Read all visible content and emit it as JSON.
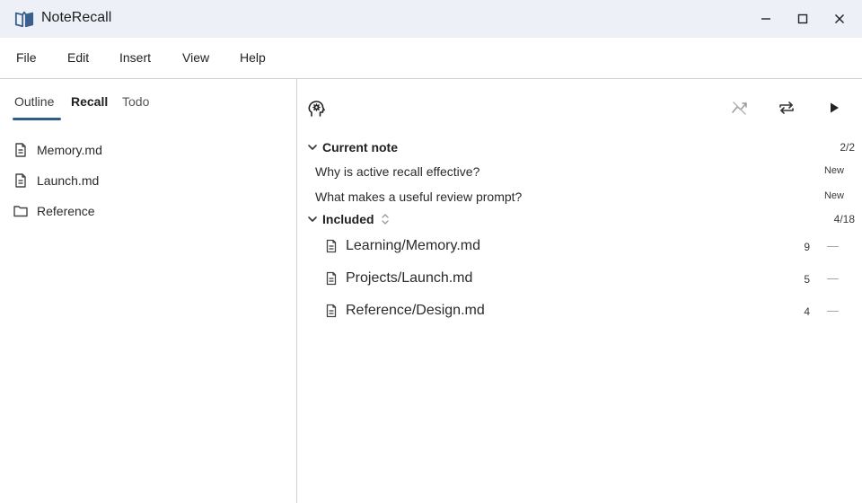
{
  "window": {
    "title": "NoteRecall",
    "icons": {
      "logo": "open-book-icon",
      "minimize": "minimize-icon",
      "maximize": "maximize-icon",
      "close": "close-icon"
    }
  },
  "menu": {
    "items": [
      "File",
      "Edit",
      "Insert",
      "View",
      "Help"
    ]
  },
  "sidebar": {
    "tabs": [
      {
        "label": "Outline",
        "active": false
      },
      {
        "label": "Recall",
        "active": true
      },
      {
        "label": "Todo",
        "active": false
      }
    ],
    "items": [
      {
        "label": "Memory.md",
        "icon": "document-icon"
      },
      {
        "label": "Launch.md",
        "icon": "document-icon"
      },
      {
        "label": "Reference",
        "icon": "folder-icon"
      }
    ]
  },
  "toolbar": {
    "icons": [
      "brain-icon",
      "trend-icon",
      "repeat-icon",
      "play-icon"
    ]
  },
  "current_note": {
    "title": "Current note",
    "count": "2/2",
    "prompts": [
      {
        "text": "Why is active recall effective?",
        "status": "New"
      },
      {
        "text": "What makes a useful review prompt?",
        "status": "New"
      }
    ]
  },
  "included": {
    "title": "Included",
    "count": "4/18",
    "files": [
      {
        "path": "Learning/Memory.md",
        "count": "9",
        "dash": "—"
      },
      {
        "path": "Projects/Launch.md",
        "count": "5",
        "dash": "—"
      },
      {
        "path": "Reference/Design.md",
        "count": "4",
        "dash": "—"
      }
    ]
  },
  "colors": {
    "accent": "#2f5d8a",
    "titlebar": "#eef0f8",
    "divider": "#d0d0d0"
  }
}
